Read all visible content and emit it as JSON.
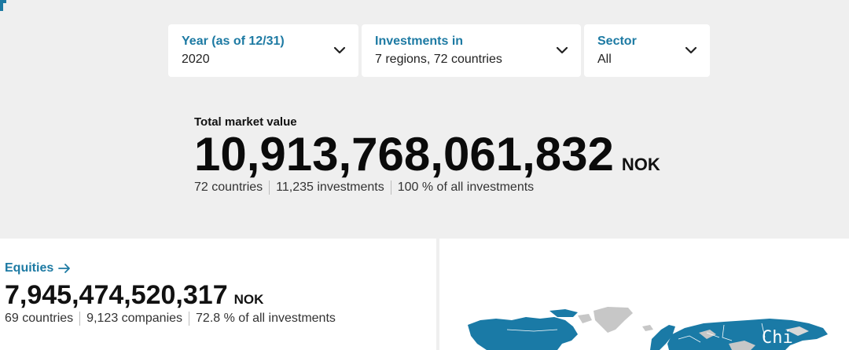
{
  "filters": [
    {
      "label": "Year (as of 12/31)",
      "value": "2020"
    },
    {
      "label": "Investments in",
      "value": "7 regions, 72 countries"
    },
    {
      "label": "Sector",
      "value": "All"
    }
  ],
  "total": {
    "label": "Total market value",
    "value": "10,913,768,061,832",
    "unit": "NOK",
    "countries": "72 countries",
    "investments": "11,235 investments",
    "share": "100 % of all investments"
  },
  "equities": {
    "label": "Equities",
    "value": "7,945,474,520,317",
    "unit": "NOK",
    "countries": "69 countries",
    "companies": "9,123 companies",
    "share": "72.8 % of all investments"
  },
  "map": {
    "overlay_text": "Chi",
    "colors": {
      "invested": "#1a7aa6",
      "other": "#c7c7c7"
    }
  },
  "icons": {
    "filter_chevron": "chevron-down-icon",
    "equities_link": "arrow-right-icon"
  }
}
